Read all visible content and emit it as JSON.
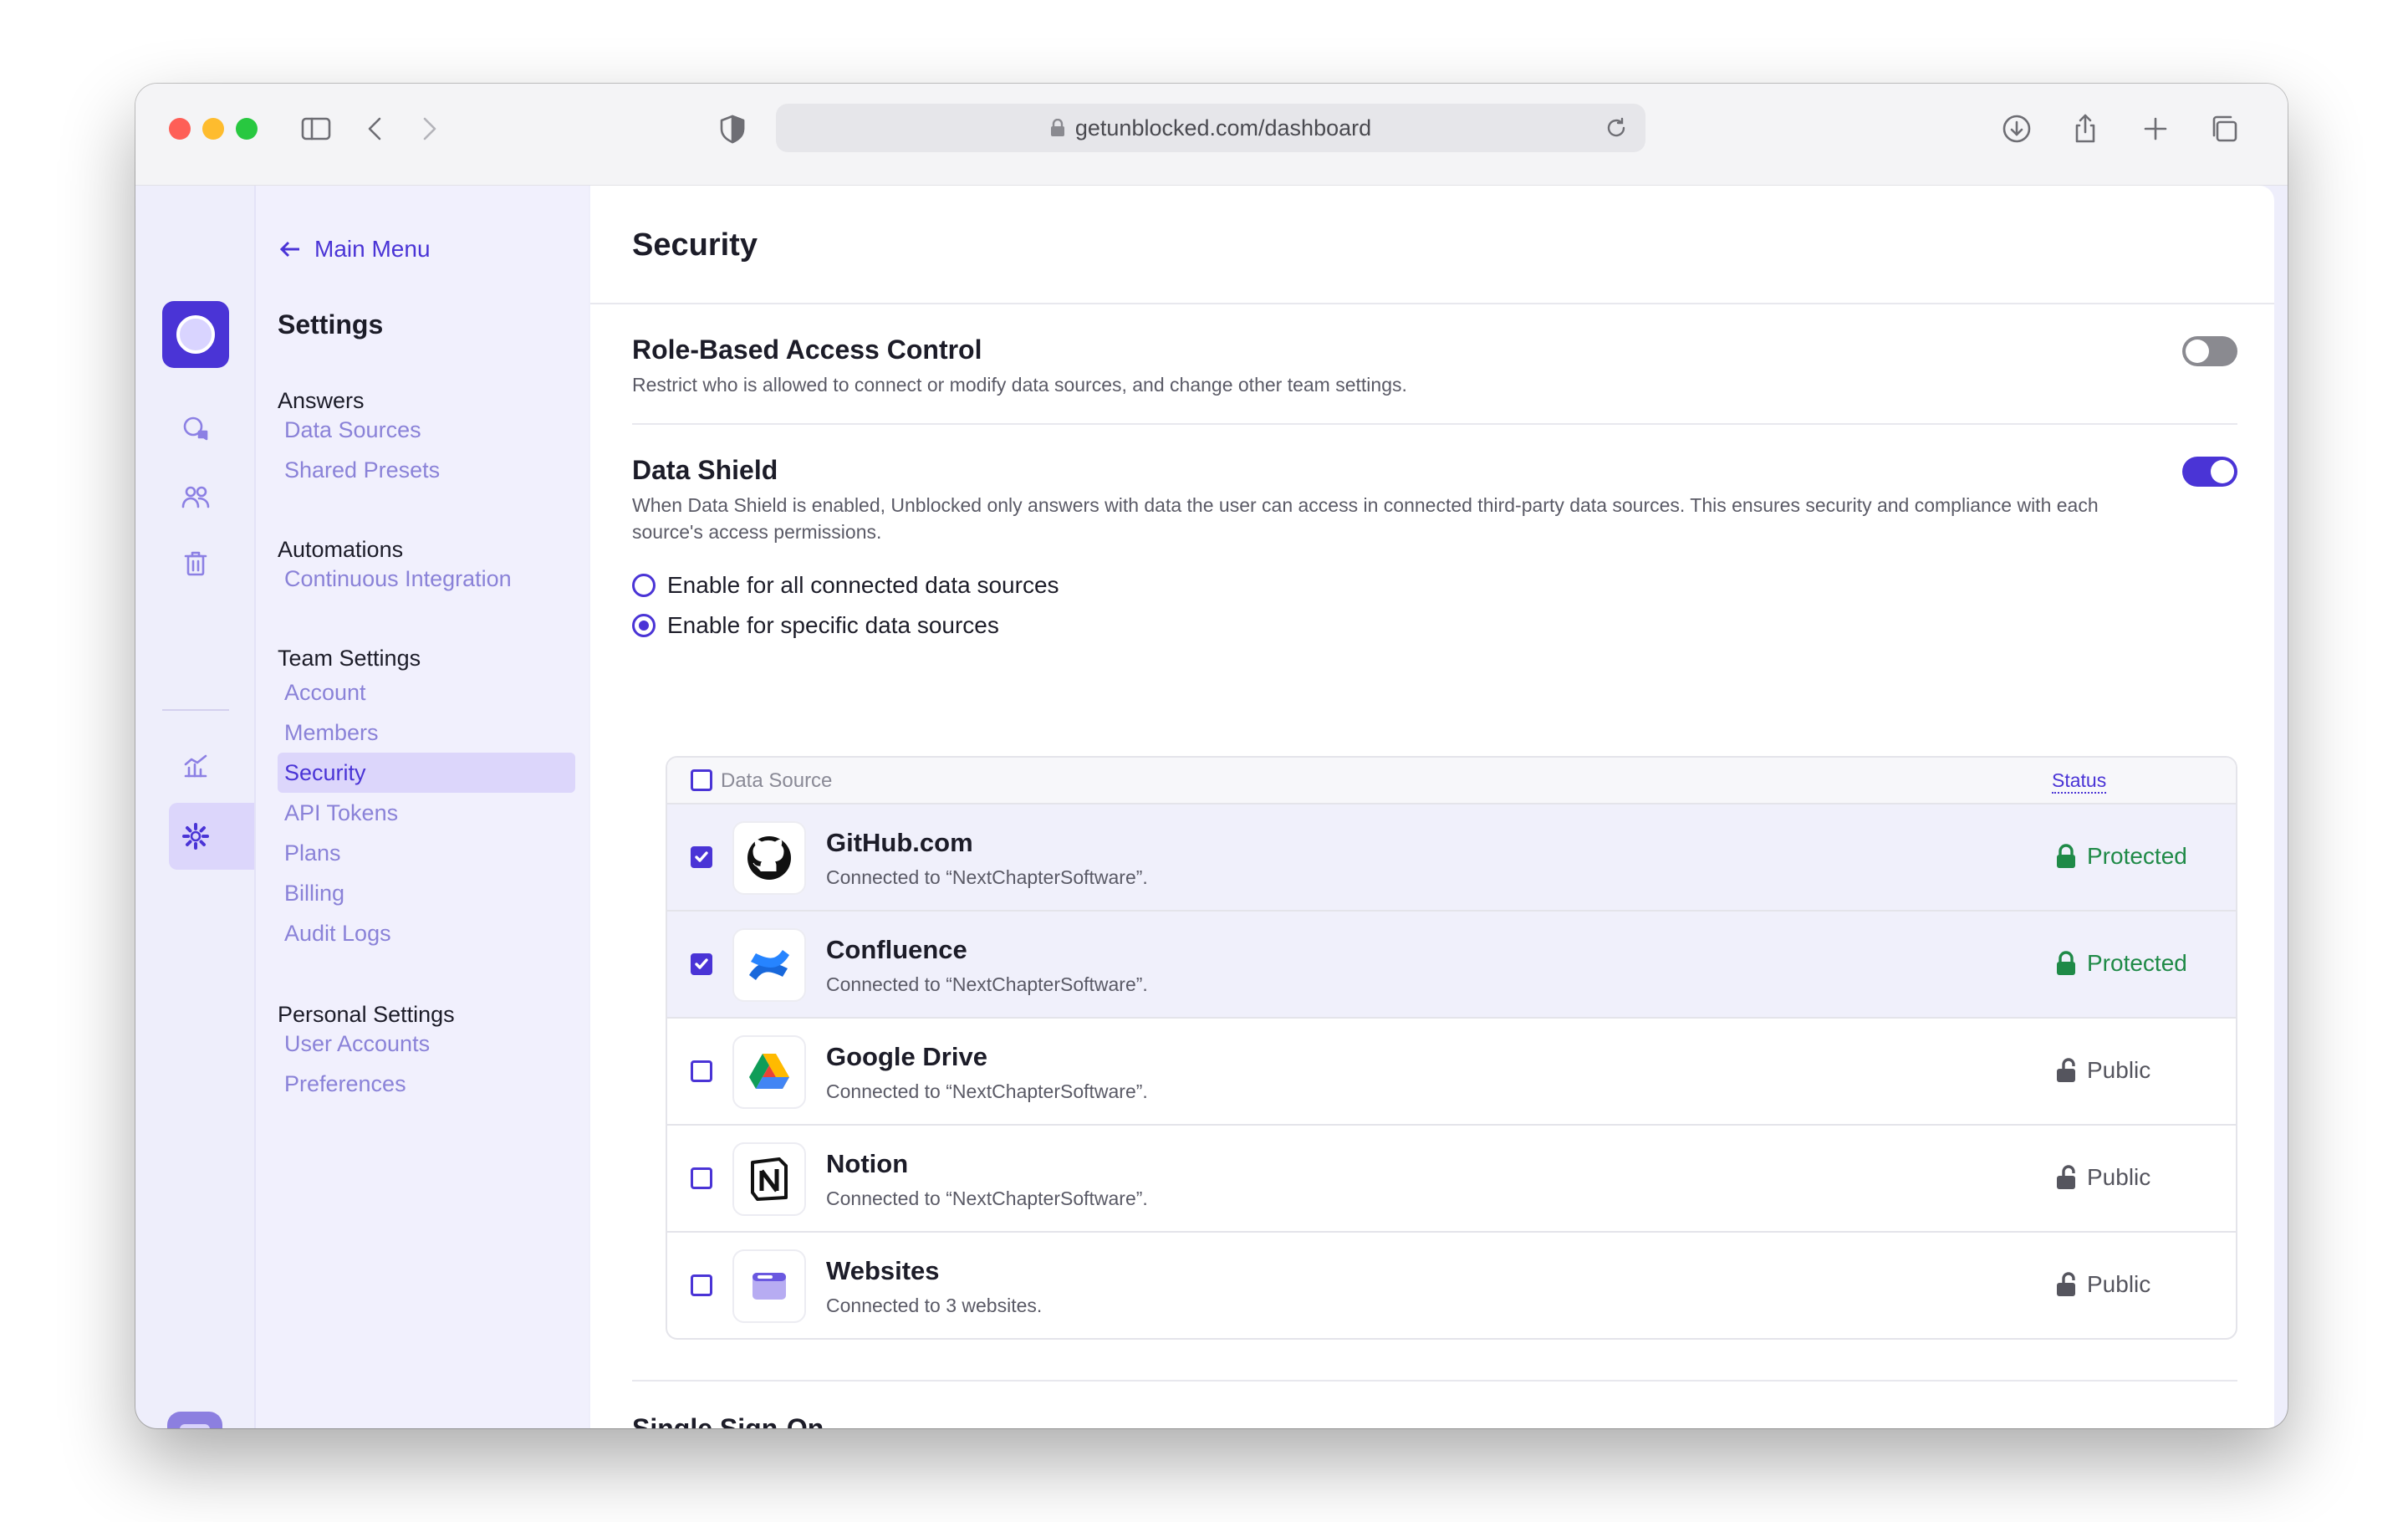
{
  "browser": {
    "url": "getunblocked.com/dashboard"
  },
  "sidebar": {
    "back_label": "Main Menu",
    "title": "Settings",
    "groups": [
      {
        "label": "Answers",
        "items": [
          "Data Sources",
          "Shared Presets"
        ]
      },
      {
        "label": "Automations",
        "items": [
          "Continuous Integration"
        ]
      },
      {
        "label": "Team Settings",
        "items": [
          "Account",
          "Members",
          "Security",
          "API Tokens",
          "Plans",
          "Billing",
          "Audit Logs"
        ]
      },
      {
        "label": "Personal Settings",
        "items": [
          "User Accounts",
          "Preferences"
        ]
      }
    ],
    "active_item": "Security"
  },
  "main": {
    "title": "Security",
    "rbac": {
      "title": "Role-Based Access Control",
      "description": "Restrict who is allowed to connect or modify data sources, and change other team settings.",
      "enabled": false
    },
    "data_shield": {
      "title": "Data Shield",
      "description": "When Data Shield is enabled, Unblocked only answers with data the user can access in connected third-party data sources. This ensures security and compliance with each source's access permissions.",
      "enabled": true,
      "options": [
        {
          "label": "Enable for all connected data sources",
          "selected": false
        },
        {
          "label": "Enable for specific data sources",
          "selected": true
        }
      ]
    },
    "table": {
      "col_source": "Data Source",
      "col_status": "Status",
      "rows": [
        {
          "name": "GitHub.com",
          "detail": "Connected to “NextChapterSoftware”.",
          "status": "Protected",
          "checked": true,
          "icon": "github-icon"
        },
        {
          "name": "Confluence",
          "detail": "Connected to “NextChapterSoftware”.",
          "status": "Protected",
          "checked": true,
          "icon": "confluence-icon"
        },
        {
          "name": "Google Drive",
          "detail": "Connected to “NextChapterSoftware”.",
          "status": "Public",
          "checked": false,
          "icon": "google-drive-icon"
        },
        {
          "name": "Notion",
          "detail": "Connected to “NextChapterSoftware”.",
          "status": "Public",
          "checked": false,
          "icon": "notion-icon"
        },
        {
          "name": "Websites",
          "detail": "Connected to 3 websites.",
          "status": "Public",
          "checked": false,
          "icon": "browser-window-icon"
        }
      ]
    },
    "sso": {
      "title": "Single Sign-On"
    }
  },
  "colors": {
    "accent": "#4a34d6",
    "protected": "#1f8a47",
    "sidebar_link": "#8a82d8"
  }
}
